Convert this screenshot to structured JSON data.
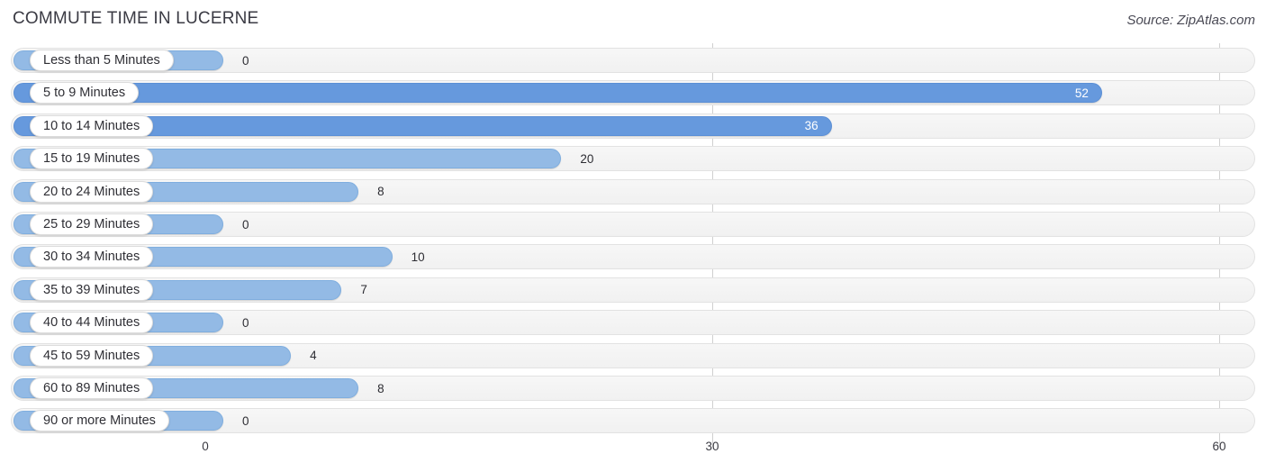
{
  "header": {
    "title": "COMMUTE TIME IN LUCERNE",
    "source": "Source: ZipAtlas.com"
  },
  "colors": {
    "bar_light": "#93bae5",
    "bar_dark": "#6699dd",
    "track": "#f4f4f4",
    "gridline": "#d0d0d0",
    "title_text": "#3b3b44"
  },
  "chart_data": {
    "type": "bar",
    "orientation": "horizontal",
    "title": "COMMUTE TIME IN LUCERNE",
    "xlabel": "",
    "ylabel": "",
    "xlim": [
      0,
      60
    ],
    "grid": true,
    "legend": false,
    "axis_ticks": [
      "0",
      "30",
      "60"
    ],
    "axis_tick_values": [
      0,
      30,
      60
    ],
    "categories": [
      "Less than 5 Minutes",
      "5 to 9 Minutes",
      "10 to 14 Minutes",
      "15 to 19 Minutes",
      "20 to 24 Minutes",
      "25 to 29 Minutes",
      "30 to 34 Minutes",
      "35 to 39 Minutes",
      "40 to 44 Minutes",
      "45 to 59 Minutes",
      "60 to 89 Minutes",
      "90 or more Minutes"
    ],
    "values": [
      0,
      52,
      36,
      20,
      8,
      0,
      10,
      7,
      0,
      4,
      8,
      0
    ],
    "value_labels": [
      "0",
      "52",
      "36",
      "20",
      "8",
      "0",
      "10",
      "7",
      "0",
      "4",
      "8",
      "0"
    ],
    "rows": [
      {
        "label": "Less than 5 Minutes",
        "value": 0,
        "value_label": "0",
        "label_inside": false
      },
      {
        "label": "5 to 9 Minutes",
        "value": 52,
        "value_label": "52",
        "label_inside": true
      },
      {
        "label": "10 to 14 Minutes",
        "value": 36,
        "value_label": "36",
        "label_inside": true
      },
      {
        "label": "15 to 19 Minutes",
        "value": 20,
        "value_label": "20",
        "label_inside": false
      },
      {
        "label": "20 to 24 Minutes",
        "value": 8,
        "value_label": "8",
        "label_inside": false
      },
      {
        "label": "25 to 29 Minutes",
        "value": 0,
        "value_label": "0",
        "label_inside": false
      },
      {
        "label": "30 to 34 Minutes",
        "value": 10,
        "value_label": "10",
        "label_inside": false
      },
      {
        "label": "35 to 39 Minutes",
        "value": 7,
        "value_label": "7",
        "label_inside": false
      },
      {
        "label": "40 to 44 Minutes",
        "value": 0,
        "value_label": "0",
        "label_inside": false
      },
      {
        "label": "45 to 59 Minutes",
        "value": 4,
        "value_label": "4",
        "label_inside": false
      },
      {
        "label": "60 to 89 Minutes",
        "value": 8,
        "value_label": "8",
        "label_inside": false
      },
      {
        "label": "90 or more Minutes",
        "value": 0,
        "value_label": "0",
        "label_inside": false
      }
    ]
  }
}
